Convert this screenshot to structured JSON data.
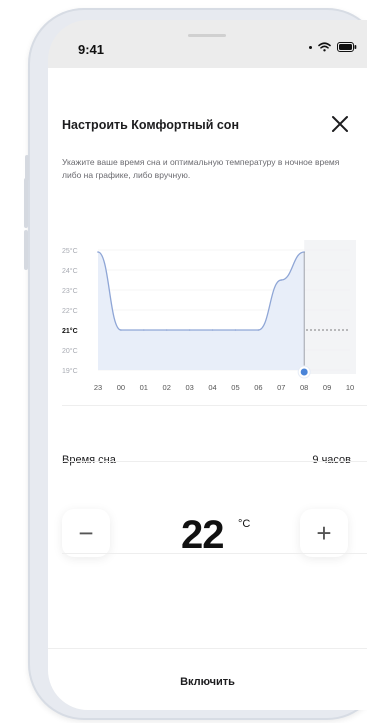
{
  "status_bar": {
    "time": "9:41"
  },
  "modal": {
    "title": "Настроить Комфортный сон",
    "description": "Укажите ваше время сна и оптимальную температуру в ночное время либо на графике, либо вручную.",
    "close_icon": "close-icon"
  },
  "chart": {
    "y_labels": [
      "25°C",
      "24°C",
      "23°C",
      "22°C",
      "21°C",
      "20°C",
      "19°C"
    ],
    "x_labels": [
      "23",
      "00",
      "01",
      "02",
      "03",
      "04",
      "05",
      "06",
      "07",
      "08",
      "09",
      "10"
    ],
    "highlighted_y": "21°C",
    "current_x": "08"
  },
  "chart_data": {
    "type": "area",
    "x": [
      "23",
      "00",
      "01",
      "02",
      "03",
      "04",
      "05",
      "06",
      "07",
      "08"
    ],
    "values": [
      24.9,
      21,
      21,
      21,
      21,
      21,
      21,
      21,
      23.5,
      24.9
    ],
    "ylim": [
      19,
      25
    ],
    "reference_line": 21,
    "accent": "#8fa6d6"
  },
  "sleep_time": {
    "label": "Время сна",
    "value": "9 часов"
  },
  "temperature": {
    "value": "22",
    "unit": "°C",
    "minus": "−",
    "plus": "+"
  },
  "footer": {
    "enable_label": "Включить"
  },
  "colors": {
    "accent": "#4a84d8",
    "line": "#8fa6d6",
    "fill": "#e8eef9"
  }
}
